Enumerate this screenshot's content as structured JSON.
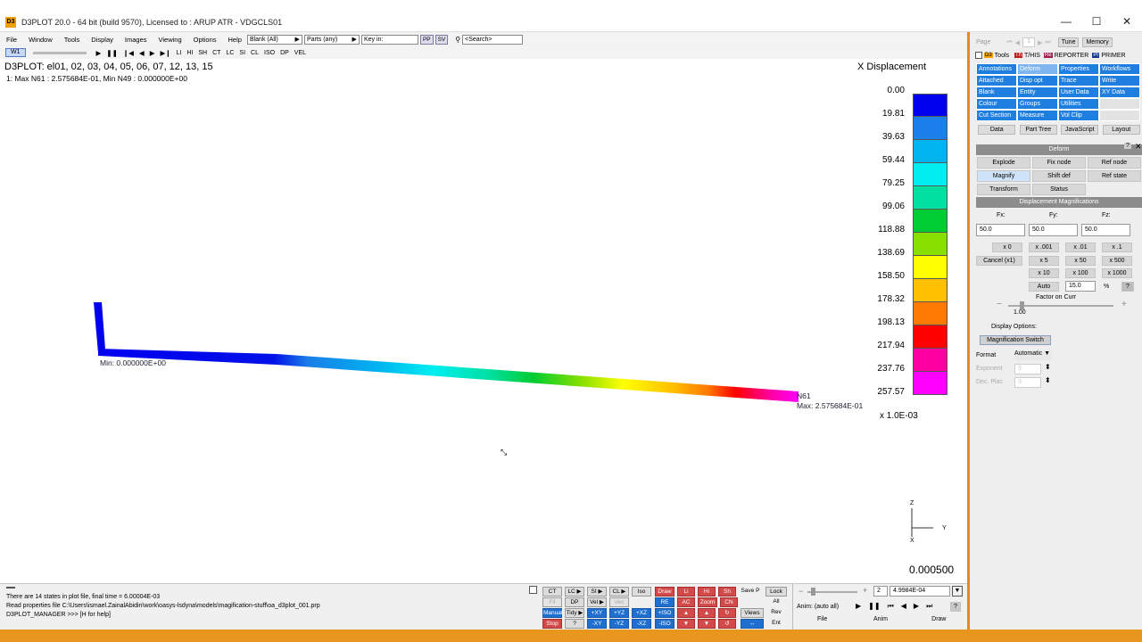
{
  "window": {
    "title": "D3PLOT 20.0 - 64 bit (build 9570), Licensed to : ARUP ATR - VDGCLS01",
    "app_icon": "D3",
    "minimize": "—",
    "maximize": "☐",
    "close": "✕"
  },
  "menu": {
    "items": [
      "File",
      "Window",
      "Tools",
      "Display",
      "Images",
      "Viewing",
      "Options",
      "Help"
    ],
    "blank_combo": "Blank (All)",
    "parts_combo": "Parts (any)",
    "key_in": "Key in:",
    "pp_btn": "PP",
    "sv_btn": "SV",
    "search_placeholder": "<Search>"
  },
  "window_toolbar": {
    "tab": "W1",
    "play": "▶",
    "pause": "❚❚",
    "prev": "❙◀",
    "back": "◀",
    "fwd": "▶",
    "next": "▶❙",
    "types": [
      "LI",
      "HI",
      "SH",
      "CT",
      "LC",
      "SI",
      "CL",
      "ISO",
      "DP",
      "VEL"
    ]
  },
  "viewport": {
    "title": "D3PLOT: el01, 02, 03, 04, 05, 06, 07, 12, 13, 15",
    "subtitle": "1: Max N61 : 2.575684E-01, Min N49 : 0.000000E+00",
    "min_label": "Min: 0.000000E+00",
    "max_node": "N61",
    "max_label": "Max: 2.575684E-01",
    "time": "0.000500",
    "triad": {
      "z": "Z",
      "y": "Y",
      "x": "X"
    }
  },
  "legend": {
    "title": "X Displacement",
    "labels": [
      "0.00",
      "19.81",
      "39.63",
      "59.44",
      "79.25",
      "99.06",
      "118.88",
      "138.69",
      "158.50",
      "178.32",
      "198.13",
      "217.94",
      "237.76",
      "257.57"
    ],
    "colors": [
      "#0000ee",
      "#1a7fe8",
      "#00b4f0",
      "#00eef0",
      "#00e0a0",
      "#00cc33",
      "#88e000",
      "#ffff00",
      "#ffc000",
      "#ff7a00",
      "#ff0000",
      "#ff00a0",
      "#ff00ff"
    ],
    "scale": "x 1.0E-03"
  },
  "right_panel": {
    "page_label": "Page",
    "page_value": "1",
    "tune": "Tune",
    "memory": "Memory",
    "tabs": [
      "Tools",
      "T/HIS",
      "REPORTER",
      "PRIMER"
    ],
    "tools_grid": [
      [
        "Annotations",
        "Deform",
        "Properties",
        "Workflows"
      ],
      [
        "Attached",
        "Disp opt",
        "Trace",
        "Write"
      ],
      [
        "Blank",
        "Entity",
        "User Data",
        "XY Data"
      ],
      [
        "Colour",
        "Groups",
        "Utilities",
        ""
      ],
      [
        "Cut Section",
        "Measure",
        "Vol Clip",
        ""
      ]
    ],
    "bottom_tabs": [
      "Data",
      "Part Tree",
      "JavaScript",
      "Layout"
    ],
    "deform_head": "Deform",
    "help": "?",
    "close": "✕",
    "deform_buttons": [
      "Explode",
      "Fix node",
      "Ref node",
      "Magnify",
      "Shift def",
      "Ref state",
      "Transform",
      "Status"
    ],
    "disp_mag_head": "Displacement Magnifications",
    "fx_label": "Fx:",
    "fy_label": "Fy:",
    "fz_label": "Fz:",
    "fx": "50.0",
    "fy": "50.0",
    "fz": "50.0",
    "mult_buttons": [
      "x 0",
      "x .001",
      "x .01",
      "x .1",
      "x 5",
      "x 50",
      "x 500",
      "x 10",
      "x 100",
      "x 1000"
    ],
    "cancel": "Cancel (x1)",
    "auto": "Auto",
    "auto_value": "15.0",
    "percent": "%",
    "factor_label": "Factor on Curr",
    "factor_value": "1.00",
    "minus": "−",
    "plus": "+",
    "display_options": "Display Options:",
    "mag_switch": "Magnification Switch",
    "format_label": "Format",
    "format_value": "Automatic",
    "exponent_label": "Exponent",
    "exponent_value": "3",
    "dec_label": "Dec. Plac",
    "dec_value": "3"
  },
  "console": {
    "line1": "There are     14 states in plot file, final time = 6.00004E-03",
    "line2": "Read properties file C:\\Users\\ismael.ZainalAbidin\\work\\oasys-lsdyna\\models\\magification-stuff\\oa_d3plot_001.prp",
    "line3": "D3PLOT_MANAGER >>> [H for help]"
  },
  "command_buttons": {
    "row1": [
      "CT",
      "LC ▶",
      "SI ▶",
      "CL ▶",
      "Iso",
      "Draw",
      "Li",
      "Hi",
      "Sh",
      "Save P",
      "Lock"
    ],
    "row2": [
      "Fil",
      "DP",
      "Vel ▶",
      "Vec",
      "RE",
      "AC",
      "Zoom",
      "CN",
      "All"
    ],
    "row3": [
      "Manual",
      "Tidy ▶",
      "+XY",
      "+YZ",
      "+XZ",
      "+ISO",
      "Views",
      "Rev"
    ],
    "row4": [
      "Stop",
      "?",
      "-XY",
      "-YZ",
      "-XZ",
      "-ISO",
      "Ent"
    ]
  },
  "animation": {
    "state": "2",
    "time": "4.9984E-04",
    "mode": "Anim: (auto all)",
    "help": "?",
    "tabs": [
      "File",
      "Anim",
      "Draw"
    ]
  }
}
